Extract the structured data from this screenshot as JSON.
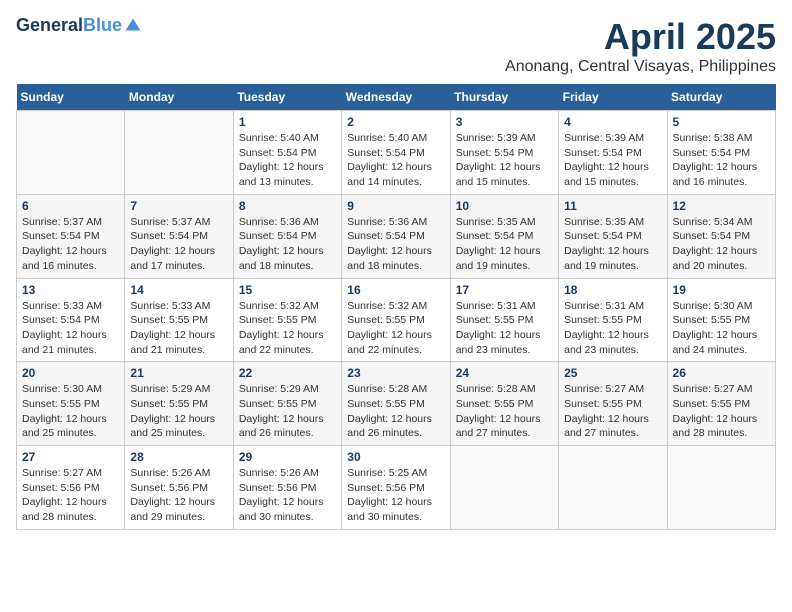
{
  "logo": {
    "line1": "General",
    "line2": "Blue"
  },
  "title": "April 2025",
  "location": "Anonang, Central Visayas, Philippines",
  "weekdays": [
    "Sunday",
    "Monday",
    "Tuesday",
    "Wednesday",
    "Thursday",
    "Friday",
    "Saturday"
  ],
  "weeks": [
    [
      {
        "day": "",
        "info": ""
      },
      {
        "day": "",
        "info": ""
      },
      {
        "day": "1",
        "info": "Sunrise: 5:40 AM\nSunset: 5:54 PM\nDaylight: 12 hours and 13 minutes."
      },
      {
        "day": "2",
        "info": "Sunrise: 5:40 AM\nSunset: 5:54 PM\nDaylight: 12 hours and 14 minutes."
      },
      {
        "day": "3",
        "info": "Sunrise: 5:39 AM\nSunset: 5:54 PM\nDaylight: 12 hours and 15 minutes."
      },
      {
        "day": "4",
        "info": "Sunrise: 5:39 AM\nSunset: 5:54 PM\nDaylight: 12 hours and 15 minutes."
      },
      {
        "day": "5",
        "info": "Sunrise: 5:38 AM\nSunset: 5:54 PM\nDaylight: 12 hours and 16 minutes."
      }
    ],
    [
      {
        "day": "6",
        "info": "Sunrise: 5:37 AM\nSunset: 5:54 PM\nDaylight: 12 hours and 16 minutes."
      },
      {
        "day": "7",
        "info": "Sunrise: 5:37 AM\nSunset: 5:54 PM\nDaylight: 12 hours and 17 minutes."
      },
      {
        "day": "8",
        "info": "Sunrise: 5:36 AM\nSunset: 5:54 PM\nDaylight: 12 hours and 18 minutes."
      },
      {
        "day": "9",
        "info": "Sunrise: 5:36 AM\nSunset: 5:54 PM\nDaylight: 12 hours and 18 minutes."
      },
      {
        "day": "10",
        "info": "Sunrise: 5:35 AM\nSunset: 5:54 PM\nDaylight: 12 hours and 19 minutes."
      },
      {
        "day": "11",
        "info": "Sunrise: 5:35 AM\nSunset: 5:54 PM\nDaylight: 12 hours and 19 minutes."
      },
      {
        "day": "12",
        "info": "Sunrise: 5:34 AM\nSunset: 5:54 PM\nDaylight: 12 hours and 20 minutes."
      }
    ],
    [
      {
        "day": "13",
        "info": "Sunrise: 5:33 AM\nSunset: 5:54 PM\nDaylight: 12 hours and 21 minutes."
      },
      {
        "day": "14",
        "info": "Sunrise: 5:33 AM\nSunset: 5:55 PM\nDaylight: 12 hours and 21 minutes."
      },
      {
        "day": "15",
        "info": "Sunrise: 5:32 AM\nSunset: 5:55 PM\nDaylight: 12 hours and 22 minutes."
      },
      {
        "day": "16",
        "info": "Sunrise: 5:32 AM\nSunset: 5:55 PM\nDaylight: 12 hours and 22 minutes."
      },
      {
        "day": "17",
        "info": "Sunrise: 5:31 AM\nSunset: 5:55 PM\nDaylight: 12 hours and 23 minutes."
      },
      {
        "day": "18",
        "info": "Sunrise: 5:31 AM\nSunset: 5:55 PM\nDaylight: 12 hours and 23 minutes."
      },
      {
        "day": "19",
        "info": "Sunrise: 5:30 AM\nSunset: 5:55 PM\nDaylight: 12 hours and 24 minutes."
      }
    ],
    [
      {
        "day": "20",
        "info": "Sunrise: 5:30 AM\nSunset: 5:55 PM\nDaylight: 12 hours and 25 minutes."
      },
      {
        "day": "21",
        "info": "Sunrise: 5:29 AM\nSunset: 5:55 PM\nDaylight: 12 hours and 25 minutes."
      },
      {
        "day": "22",
        "info": "Sunrise: 5:29 AM\nSunset: 5:55 PM\nDaylight: 12 hours and 26 minutes."
      },
      {
        "day": "23",
        "info": "Sunrise: 5:28 AM\nSunset: 5:55 PM\nDaylight: 12 hours and 26 minutes."
      },
      {
        "day": "24",
        "info": "Sunrise: 5:28 AM\nSunset: 5:55 PM\nDaylight: 12 hours and 27 minutes."
      },
      {
        "day": "25",
        "info": "Sunrise: 5:27 AM\nSunset: 5:55 PM\nDaylight: 12 hours and 27 minutes."
      },
      {
        "day": "26",
        "info": "Sunrise: 5:27 AM\nSunset: 5:55 PM\nDaylight: 12 hours and 28 minutes."
      }
    ],
    [
      {
        "day": "27",
        "info": "Sunrise: 5:27 AM\nSunset: 5:56 PM\nDaylight: 12 hours and 28 minutes."
      },
      {
        "day": "28",
        "info": "Sunrise: 5:26 AM\nSunset: 5:56 PM\nDaylight: 12 hours and 29 minutes."
      },
      {
        "day": "29",
        "info": "Sunrise: 5:26 AM\nSunset: 5:56 PM\nDaylight: 12 hours and 30 minutes."
      },
      {
        "day": "30",
        "info": "Sunrise: 5:25 AM\nSunset: 5:56 PM\nDaylight: 12 hours and 30 minutes."
      },
      {
        "day": "",
        "info": ""
      },
      {
        "day": "",
        "info": ""
      },
      {
        "day": "",
        "info": ""
      }
    ]
  ]
}
